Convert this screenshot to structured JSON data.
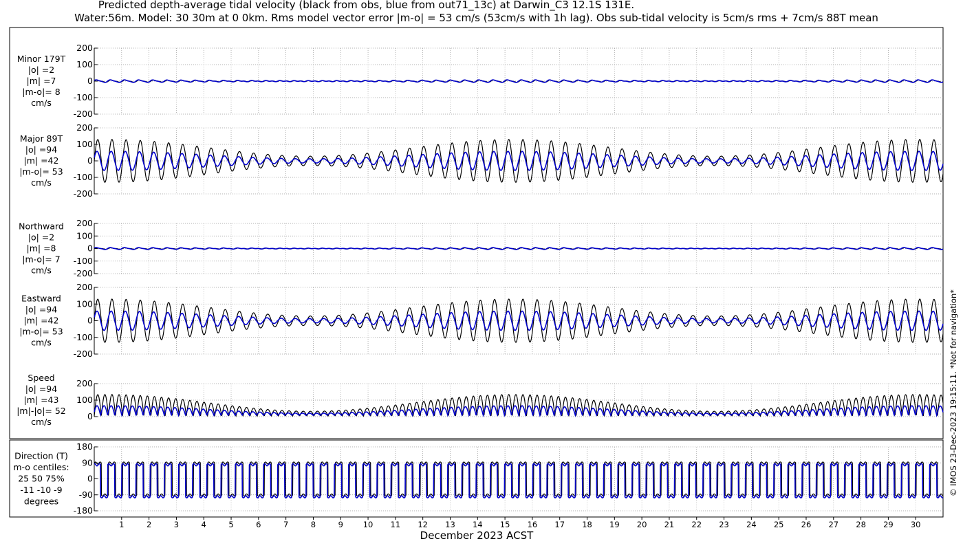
{
  "header": {
    "title_line1": "Predicted depth-average tidal velocity (black from obs, blue from out71_13c) at Darwin_C3 12.1S 131E.",
    "title_line2": "Water:56m. Model: 30 30m at 0 0km. Rms model vector error |m-o| = 53 cm/s (53cm/s with 1h lag). Obs sub-tidal velocity is 5cm/s rms + 7cm/s 88T mean"
  },
  "footer": {
    "xlabel": "December 2023 ACST",
    "copyright": "© IMOS 23-Dec-2023 19:15:11. *Not for navigation*"
  },
  "colors": {
    "obs": "#000000",
    "model": "#0000cc",
    "grid": "#999999",
    "frame": "#000000"
  },
  "chart_data": [
    {
      "type": "line",
      "name": "minor",
      "label_lines": [
        "Minor 179T",
        "|o| =2",
        "|m| =7",
        "|m-o|= 8",
        "cm/s"
      ],
      "ylim": [
        -200,
        200
      ],
      "yticks": [
        200,
        100,
        0,
        -100,
        -200
      ],
      "x_days": [
        0,
        31
      ],
      "obs_amp": 6,
      "model_amp": 7,
      "series": [
        {
          "name": "obs",
          "color": "#000000"
        },
        {
          "name": "model",
          "color": "#0000cc"
        }
      ]
    },
    {
      "type": "line",
      "name": "major",
      "label_lines": [
        "Major 89T",
        "|o| =94",
        "|m| =42",
        "|m-o|= 53",
        "cm/s"
      ],
      "ylim": [
        -200,
        200
      ],
      "yticks": [
        200,
        100,
        0,
        -100,
        -200
      ],
      "x_days": [
        0,
        31
      ],
      "obs_amp": 130,
      "model_amp": 58,
      "series": [
        {
          "name": "obs",
          "color": "#000000"
        },
        {
          "name": "model",
          "color": "#0000cc"
        }
      ]
    },
    {
      "type": "line",
      "name": "northward",
      "label_lines": [
        "Northward",
        "|o| =2",
        "|m| =8",
        "|m-o|= 7",
        "cm/s"
      ],
      "ylim": [
        -200,
        200
      ],
      "yticks": [
        200,
        100,
        0,
        -100,
        -200
      ],
      "x_days": [
        0,
        31
      ],
      "obs_amp": 5,
      "model_amp": 7,
      "series": [
        {
          "name": "obs",
          "color": "#000000"
        },
        {
          "name": "model",
          "color": "#0000cc"
        }
      ]
    },
    {
      "type": "line",
      "name": "eastward",
      "label_lines": [
        "Eastward",
        "|o| =94",
        "|m| =42",
        "|m-o|= 53",
        "cm/s"
      ],
      "ylim": [
        -200,
        200
      ],
      "yticks": [
        200,
        100,
        0,
        -100,
        -200
      ],
      "x_days": [
        0,
        31
      ],
      "obs_amp": 130,
      "model_amp": 58,
      "series": [
        {
          "name": "obs",
          "color": "#000000"
        },
        {
          "name": "model",
          "color": "#0000cc"
        }
      ]
    },
    {
      "type": "line",
      "name": "speed",
      "label_lines": [
        "Speed",
        "|o| =94",
        "|m| =43",
        "|m|-|o|= 52",
        "cm/s"
      ],
      "ylim": [
        0,
        200
      ],
      "yticks": [
        200,
        100,
        0
      ],
      "x_days": [
        0,
        31
      ],
      "obs_amp": 130,
      "model_amp": 58,
      "series": [
        {
          "name": "obs",
          "color": "#000000"
        },
        {
          "name": "model",
          "color": "#0000cc"
        }
      ]
    },
    {
      "type": "line",
      "name": "direction",
      "label_lines": [
        "Direction (T)",
        "m-o centiles:",
        "25  50  75%",
        "-11 -10  -9",
        "degrees"
      ],
      "ylim": [
        -180,
        180
      ],
      "yticks": [
        180,
        90,
        0,
        -90,
        -180
      ],
      "x_days": [
        0,
        31
      ],
      "flood_dir": 89,
      "ebb_dir": -91,
      "series": [
        {
          "name": "obs",
          "color": "#000000"
        },
        {
          "name": "model",
          "color": "#0000cc"
        }
      ]
    }
  ],
  "xaxis": {
    "ticks": [
      "1",
      "2",
      "3",
      "4",
      "5",
      "6",
      "7",
      "8",
      "9",
      "10",
      "11",
      "12",
      "13",
      "14",
      "15",
      "16",
      "17",
      "18",
      "19",
      "20",
      "21",
      "22",
      "23",
      "24",
      "25",
      "26",
      "27",
      "28",
      "29",
      "30"
    ],
    "range_days": [
      0,
      31
    ]
  }
}
